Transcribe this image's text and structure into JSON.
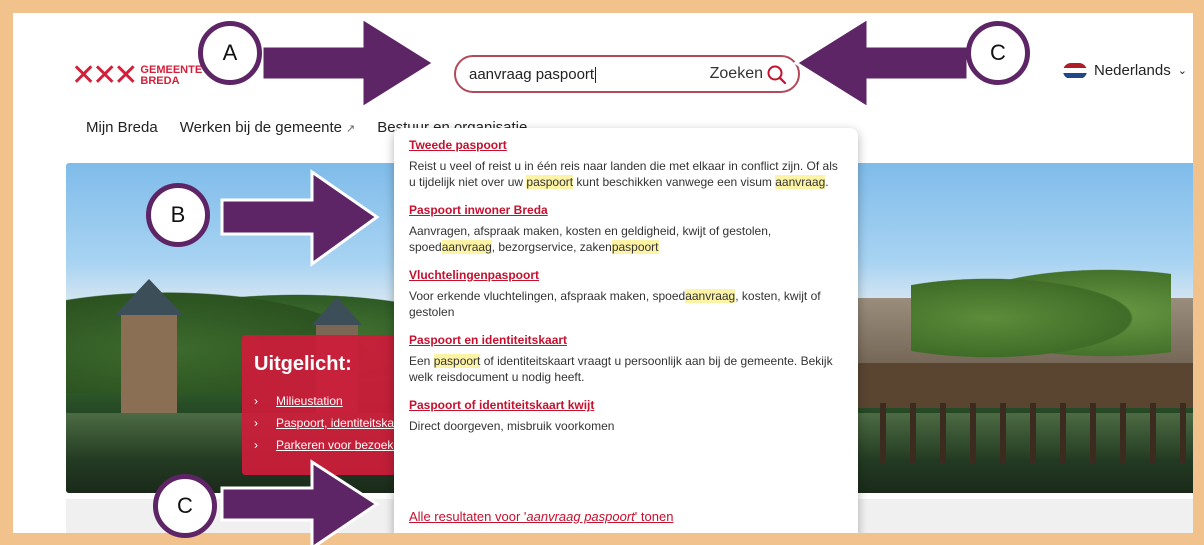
{
  "header": {
    "logo_marks": "✕✕✕",
    "logo_line1": "GEMEENTE",
    "logo_line2": "BREDA",
    "search": {
      "value": "aanvraag paspoort",
      "button_label": "Zoeken"
    },
    "language": "Nederlands"
  },
  "nav": {
    "items": [
      "Mijn Breda",
      "Werken bij de gemeente",
      "Bestuur en organisatie"
    ]
  },
  "featured": {
    "title": "Uitgelicht:",
    "items": [
      "Milieustation",
      "Paspoort, identiteitskaart",
      "Parkeren voor bezoekers"
    ]
  },
  "dropdown": {
    "results": [
      {
        "title": "Tweede paspoort",
        "text_parts": [
          "Reist u veel of reist u in één reis naar landen die met elkaar in conflict zijn. Of als u tijdelijk niet over uw ",
          "paspoort",
          " kunt beschikken vanwege een visum ",
          "aanvraag",
          "."
        ]
      },
      {
        "title": "Paspoort inwoner Breda",
        "text_parts": [
          "Aanvragen, afspraak maken, kosten en geldigheid, kwijt of gestolen, spoed",
          "aanvraag",
          ", bezorgservice, zaken",
          "paspoort",
          ""
        ]
      },
      {
        "title": "Vluchtelingenpaspoort",
        "text_parts": [
          "Voor erkende vluchtelingen, afspraak maken, spoed",
          "aanvraag",
          ", kosten, kwijt of gestolen",
          "",
          ""
        ]
      },
      {
        "title": "Paspoort en identiteitskaart",
        "text_parts": [
          "Een ",
          "paspoort",
          " of identiteitskaart vraagt u persoonlijk aan bij de gemeente. Bekijk welk reisdocument u nodig heeft.",
          "",
          ""
        ]
      },
      {
        "title": "Paspoort of identiteitskaart kwijt",
        "text_parts": [
          "Direct doorgeven, misbruik voorkomen",
          "",
          "",
          "",
          ""
        ]
      }
    ],
    "all_results": {
      "prefix": "Alle resultaten voor '",
      "query": "aanvraag paspoort",
      "suffix": "' tonen"
    }
  },
  "annotations": {
    "labels": [
      "A",
      "B",
      "C",
      "C"
    ],
    "color": "#5e2566"
  },
  "colors": {
    "accent": "#c5102e",
    "border": "#f2c28c",
    "highlight": "#fdf3a5"
  }
}
